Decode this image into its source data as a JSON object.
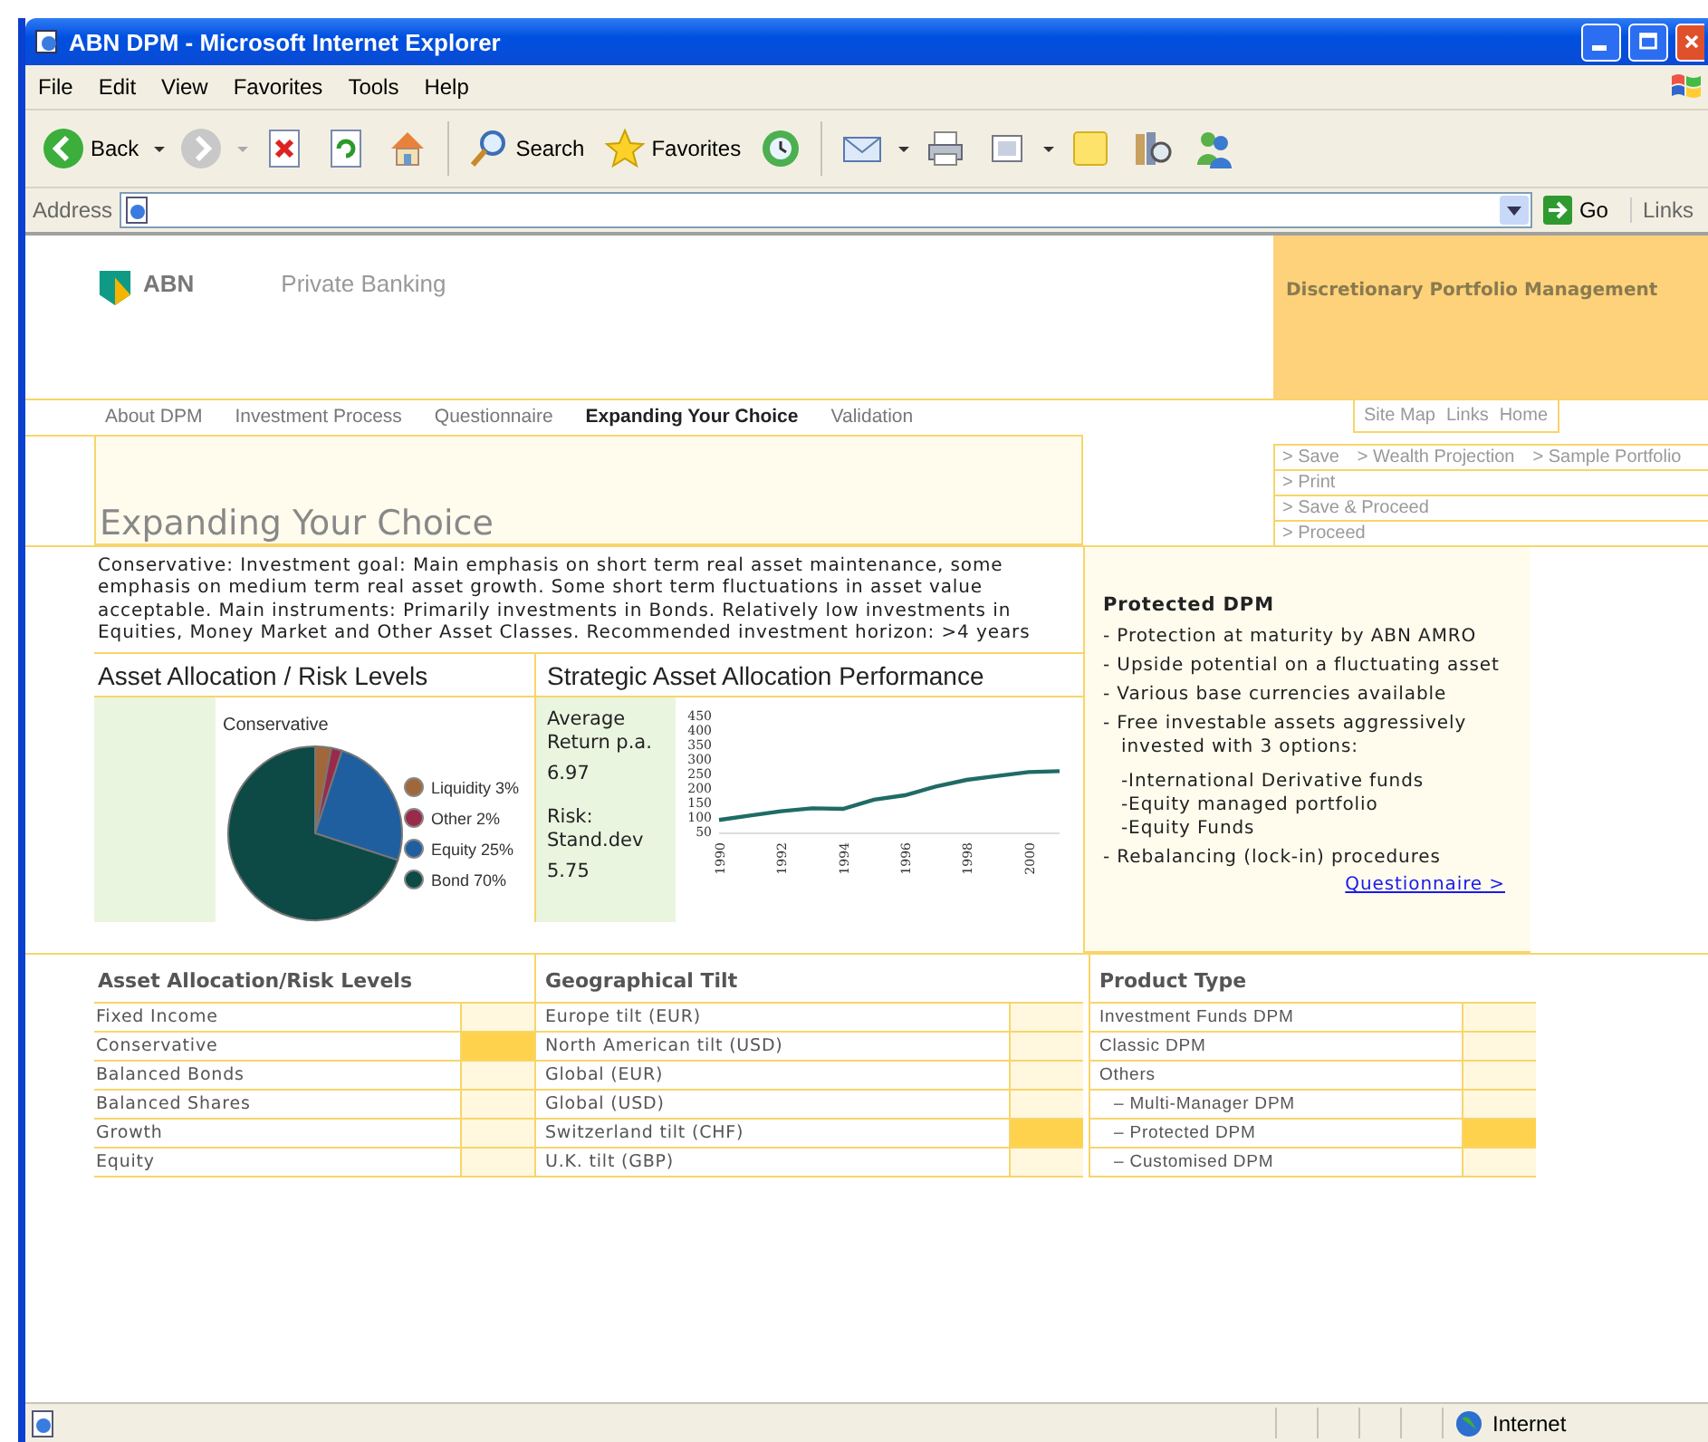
{
  "window": {
    "title": "ABN DPM - Microsoft Internet Explorer"
  },
  "menu": [
    "File",
    "Edit",
    "View",
    "Favorites",
    "Tools",
    "Help"
  ],
  "toolbar": {
    "back": "Back",
    "search": "Search",
    "favorites": "Favorites"
  },
  "address_bar": {
    "label": "Address",
    "go": "Go",
    "links": "Links"
  },
  "page": {
    "brand": "ABN",
    "subtitle": "Private Banking",
    "banner": "Discretionary Portfolio Management",
    "nav": [
      {
        "label": "About DPM",
        "selected": false
      },
      {
        "label": "Investment Process",
        "selected": false
      },
      {
        "label": "Questionnaire",
        "selected": false
      },
      {
        "label": "Expanding Your Choice",
        "selected": true
      },
      {
        "label": "Validation",
        "selected": false
      }
    ],
    "utility_links": [
      "Site Map",
      "Links",
      "Home"
    ],
    "actions": [
      [
        "> Save",
        "> Wealth Projection",
        "> Sample Portfolio"
      ],
      [
        "> Print"
      ],
      [
        "> Save & Proceed"
      ],
      [
        "> Proceed"
      ]
    ],
    "heading": "Expanding Your Choice",
    "description": "Conservative: Investment goal: Main emphasis on short term real asset maintenance, some emphasis on medium term real asset growth. Some short term fluctuations in asset value acceptable. Main instruments: Primarily investments in Bonds. Relatively low investments in Equities, Money Market and Other Asset Classes. Recommended investment horizon: >4 years",
    "allocation": {
      "title": "Asset Allocation / Risk Levels",
      "chart_data": {
        "type": "pie",
        "title": "Conservative",
        "categories": [
          "Liquidity 3%",
          "Other 2%",
          "Equity 25%",
          "Bond 70%"
        ],
        "values": [
          3,
          2,
          25,
          70
        ],
        "colors": [
          "#a0683a",
          "#9a2a4a",
          "#1f5fa0",
          "#0d4a45"
        ],
        "legend": "right"
      }
    },
    "performance": {
      "title": "Strategic Asset Allocation Performance",
      "stats": [
        {
          "label": "Average Return p.a.",
          "value": "6.97"
        },
        {
          "label": "Risk: Stand.dev",
          "value": "5.75"
        }
      ],
      "chart_data": {
        "type": "line",
        "x": [
          1990,
          1991,
          1992,
          1993,
          1994,
          1995,
          1996,
          1997,
          1998,
          1999,
          2000,
          2001
        ],
        "series": [
          {
            "color": "#1f6b66",
            "values": [
              90,
              105,
              120,
              130,
              128,
              160,
              175,
              205,
              228,
              242,
              255,
              258
            ]
          }
        ],
        "ylim": [
          50,
          450
        ],
        "yticks": [
          50,
          100,
          150,
          200,
          250,
          300,
          350,
          400,
          450
        ],
        "xlim": [
          1990,
          2001
        ],
        "xticks": [
          1990,
          1992,
          1994,
          1996,
          1998,
          2000
        ]
      }
    },
    "protected": {
      "title": "Protected DPM",
      "items": [
        {
          "kind": "bullet",
          "text": "- Protection at maturity by ABN AMRO"
        },
        {
          "kind": "bullet",
          "text": "- Upside potential on a fluctuating asset"
        },
        {
          "kind": "bullet",
          "text": "- Various base currencies available"
        },
        {
          "kind": "bullet",
          "text": "- Free investable assets aggressively invested with 3 options:"
        },
        {
          "kind": "sub",
          "text": "-International Derivative funds"
        },
        {
          "kind": "sub",
          "text": "-Equity managed portfolio"
        },
        {
          "kind": "sub",
          "text": "-Equity Funds"
        },
        {
          "kind": "bullet",
          "text": "- Rebalancing (lock-in) procedures"
        }
      ],
      "link": "Questionnaire >"
    },
    "tables": [
      {
        "title": "Asset Allocation/Risk Levels",
        "rows": [
          {
            "label": "Fixed Income",
            "selected": false
          },
          {
            "label": "Conservative",
            "selected": true
          },
          {
            "label": "Balanced Bonds",
            "selected": false
          },
          {
            "label": "Balanced Shares",
            "selected": false
          },
          {
            "label": "Growth",
            "selected": false
          },
          {
            "label": "Equity",
            "selected": false
          }
        ]
      },
      {
        "title": "Geographical Tilt",
        "rows": [
          {
            "label": "Europe tilt (EUR)",
            "selected": false
          },
          {
            "label": "North American tilt (USD)",
            "selected": false
          },
          {
            "label": "Global (EUR)",
            "selected": false
          },
          {
            "label": "Global (USD)",
            "selected": false
          },
          {
            "label": "Switzerland tilt (CHF)",
            "selected": true
          },
          {
            "label": "U.K. tilt (GBP)",
            "selected": false
          }
        ]
      },
      {
        "title": "Product Type",
        "rows": [
          {
            "label": "Investment Funds DPM",
            "selected": false
          },
          {
            "label": "Classic DPM",
            "selected": false
          },
          {
            "label": "Others",
            "selected": false,
            "children": [
              {
                "label": "– Multi-Manager DPM",
                "selected": false
              },
              {
                "label": "– Protected DPM",
                "selected": true
              },
              {
                "label": "– Customised DPM",
                "selected": false
              }
            ]
          }
        ]
      }
    ]
  },
  "status_bar": {
    "zone": "Internet"
  }
}
